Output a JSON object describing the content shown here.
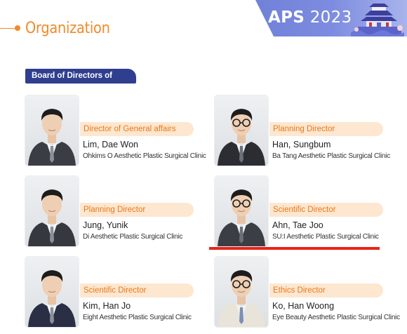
{
  "header": {
    "title": "Organization",
    "banner": {
      "brand": "APS",
      "year": "2023"
    }
  },
  "section": {
    "label": "Board of Directors of KAPS"
  },
  "colors": {
    "accent": "#f08a2c",
    "badge": "#2f3e8f",
    "role_bg": "#fde7d0",
    "highlight": "#e8231a"
  },
  "members": [
    {
      "role": "Director of General affairs",
      "name": "Lim, Dae Won",
      "clinic": "Ohkims O Aesthetic Plastic Surgical Clinic",
      "glasses": false,
      "suit": "#3a3d44"
    },
    {
      "role": "Planning Director",
      "name": "Han, Sungbum",
      "clinic": "Ba Tang Aesthetic Plastic Surgical Clinic",
      "glasses": true,
      "suit": "#2b2d33"
    },
    {
      "role": "Planning Director",
      "name": "Jung, Yunik",
      "clinic": "Di Aesthetic Plastic Surgical Clinic",
      "glasses": false,
      "suit": "#35383f"
    },
    {
      "role": "Scientific Director",
      "name": "Ahn, Tae Joo",
      "clinic": "SU:I Aesthetic Plastic Surgical Clinic",
      "glasses": true,
      "suit": "#3b3e45"
    },
    {
      "role": "Scientific Director",
      "name": "Kim, Han Jo",
      "clinic": "Eight Aesthetic Plastic Surgical Clinic",
      "glasses": false,
      "suit": "#2a2f45"
    },
    {
      "role": "Ethics Director",
      "name": "Ko, Han Woong",
      "clinic": "Eye Beauty Aesthetic Plastic Surgical Clinic",
      "glasses": true,
      "suit": "#e9e4da"
    }
  ]
}
